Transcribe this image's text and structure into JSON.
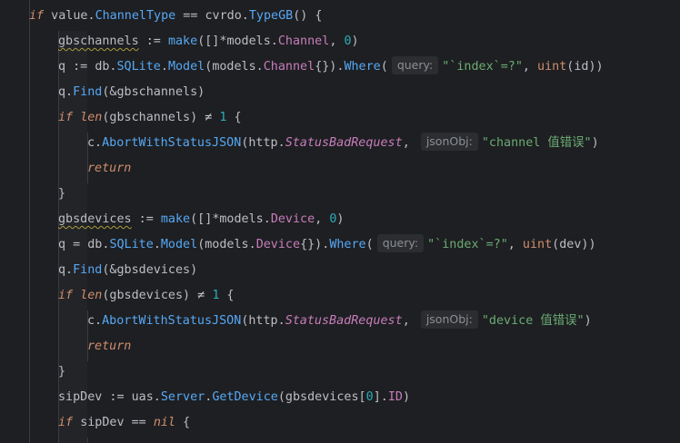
{
  "code_lines": [
    {
      "id": "l1",
      "indent": 1,
      "tokens": [
        [
          "kwi",
          "if"
        ],
        [
          "var",
          " value."
        ],
        [
          "fn",
          "ChannelType"
        ],
        [
          "op",
          " == "
        ],
        [
          "var",
          "cvrdo."
        ],
        [
          "fn",
          "TypeGB"
        ],
        [
          "op",
          "() {"
        ]
      ]
    },
    {
      "id": "l2",
      "indent": 2,
      "tokens": [
        [
          "var wavy",
          "gbschannels"
        ],
        [
          "op",
          " := "
        ],
        [
          "fn",
          "make"
        ],
        [
          "op",
          "([]"
        ],
        [
          "op",
          "*"
        ],
        [
          "pkg",
          "models."
        ],
        [
          "ty",
          "Channel"
        ],
        [
          "op",
          ", "
        ],
        [
          "num",
          "0"
        ],
        [
          "op",
          ")"
        ]
      ]
    },
    {
      "id": "l3",
      "indent": 2,
      "tokens": [
        [
          "var",
          "q := "
        ],
        [
          "var",
          "db."
        ],
        [
          "fn",
          "SQLite"
        ],
        [
          "op",
          "."
        ],
        [
          "fn",
          "Model"
        ],
        [
          "op",
          "("
        ],
        [
          "pkg",
          "models."
        ],
        [
          "ty",
          "Channel"
        ],
        [
          "op",
          "{})."
        ],
        [
          "fn",
          "Where"
        ],
        [
          "op",
          "("
        ],
        [
          "hint",
          "query:"
        ],
        [
          "str",
          "\"`index`=?\""
        ],
        [
          "op",
          ", "
        ],
        [
          "kw",
          "uint"
        ],
        [
          "op",
          "(id))"
        ]
      ]
    },
    {
      "id": "l4",
      "indent": 2,
      "tokens": [
        [
          "var",
          "q."
        ],
        [
          "fn",
          "Find"
        ],
        [
          "op",
          "(&gbschannels)"
        ]
      ]
    },
    {
      "id": "l5",
      "indent": 2,
      "tokens": [
        [
          "kwi",
          "if "
        ],
        [
          "builtin",
          "len"
        ],
        [
          "op",
          "(gbschannels) ≠ "
        ],
        [
          "num",
          "1"
        ],
        [
          "op",
          " {"
        ]
      ]
    },
    {
      "id": "l6",
      "indent": 3,
      "tokens": [
        [
          "var",
          "c."
        ],
        [
          "fn",
          "AbortWithStatusJSON"
        ],
        [
          "op",
          "("
        ],
        [
          "pkg",
          "http."
        ],
        [
          "const",
          "StatusBadRequest"
        ],
        [
          "op",
          ", "
        ],
        [
          "hint",
          "jsonObj:"
        ],
        [
          "str",
          "\"channel 值错误\""
        ],
        [
          "op",
          ")"
        ]
      ]
    },
    {
      "id": "l7",
      "indent": 3,
      "tokens": [
        [
          "kwi",
          "return"
        ]
      ]
    },
    {
      "id": "l8",
      "indent": 2,
      "tokens": [
        [
          "op",
          "}"
        ]
      ]
    },
    {
      "id": "l9",
      "indent": 2,
      "tokens": [
        [
          "var wavy",
          "gbsdevices"
        ],
        [
          "op",
          " := "
        ],
        [
          "fn",
          "make"
        ],
        [
          "op",
          "([]"
        ],
        [
          "op",
          "*"
        ],
        [
          "pkg",
          "models."
        ],
        [
          "ty",
          "Device"
        ],
        [
          "op",
          ", "
        ],
        [
          "num",
          "0"
        ],
        [
          "op",
          ")"
        ]
      ]
    },
    {
      "id": "l10",
      "indent": 2,
      "tokens": [
        [
          "var",
          "q = "
        ],
        [
          "var",
          "db."
        ],
        [
          "fn",
          "SQLite"
        ],
        [
          "op",
          "."
        ],
        [
          "fn",
          "Model"
        ],
        [
          "op",
          "("
        ],
        [
          "pkg",
          "models."
        ],
        [
          "ty",
          "Device"
        ],
        [
          "op",
          "{})."
        ],
        [
          "fn",
          "Where"
        ],
        [
          "op",
          "("
        ],
        [
          "hint",
          "query:"
        ],
        [
          "str",
          "\"`index`=?\""
        ],
        [
          "op",
          ", "
        ],
        [
          "kw",
          "uint"
        ],
        [
          "op",
          "(dev))"
        ]
      ]
    },
    {
      "id": "l11",
      "indent": 2,
      "tokens": [
        [
          "var",
          "q."
        ],
        [
          "fn",
          "Find"
        ],
        [
          "op",
          "(&gbsdevices)"
        ]
      ]
    },
    {
      "id": "l12",
      "indent": 2,
      "tokens": [
        [
          "kwi",
          "if "
        ],
        [
          "builtin",
          "len"
        ],
        [
          "op",
          "(gbsdevices) ≠ "
        ],
        [
          "num",
          "1"
        ],
        [
          "op",
          " {"
        ]
      ]
    },
    {
      "id": "l13",
      "indent": 3,
      "tokens": [
        [
          "var",
          "c."
        ],
        [
          "fn",
          "AbortWithStatusJSON"
        ],
        [
          "op",
          "("
        ],
        [
          "pkg",
          "http."
        ],
        [
          "const",
          "StatusBadRequest"
        ],
        [
          "op",
          ", "
        ],
        [
          "hint",
          "jsonObj:"
        ],
        [
          "str",
          "\"device 值错误\""
        ],
        [
          "op",
          ")"
        ]
      ]
    },
    {
      "id": "l14",
      "indent": 3,
      "tokens": [
        [
          "kwi",
          "return"
        ]
      ]
    },
    {
      "id": "l15",
      "indent": 2,
      "tokens": [
        [
          "op",
          "}"
        ]
      ]
    },
    {
      "id": "l16",
      "indent": 2,
      "tokens": [
        [
          "var",
          "sipDev := "
        ],
        [
          "var",
          "uas."
        ],
        [
          "fn",
          "Server"
        ],
        [
          "op",
          "."
        ],
        [
          "fn",
          "GetDevice"
        ],
        [
          "op",
          "(gbsdevices["
        ],
        [
          "num",
          "0"
        ],
        [
          "op",
          "]."
        ],
        [
          "field",
          "ID"
        ],
        [
          "op",
          ")"
        ]
      ]
    },
    {
      "id": "l17",
      "indent": 2,
      "tokens": [
        [
          "kwi",
          "if "
        ],
        [
          "var",
          "sipDev == "
        ],
        [
          "kwi",
          "nil"
        ],
        [
          "op",
          " {"
        ]
      ]
    }
  ]
}
